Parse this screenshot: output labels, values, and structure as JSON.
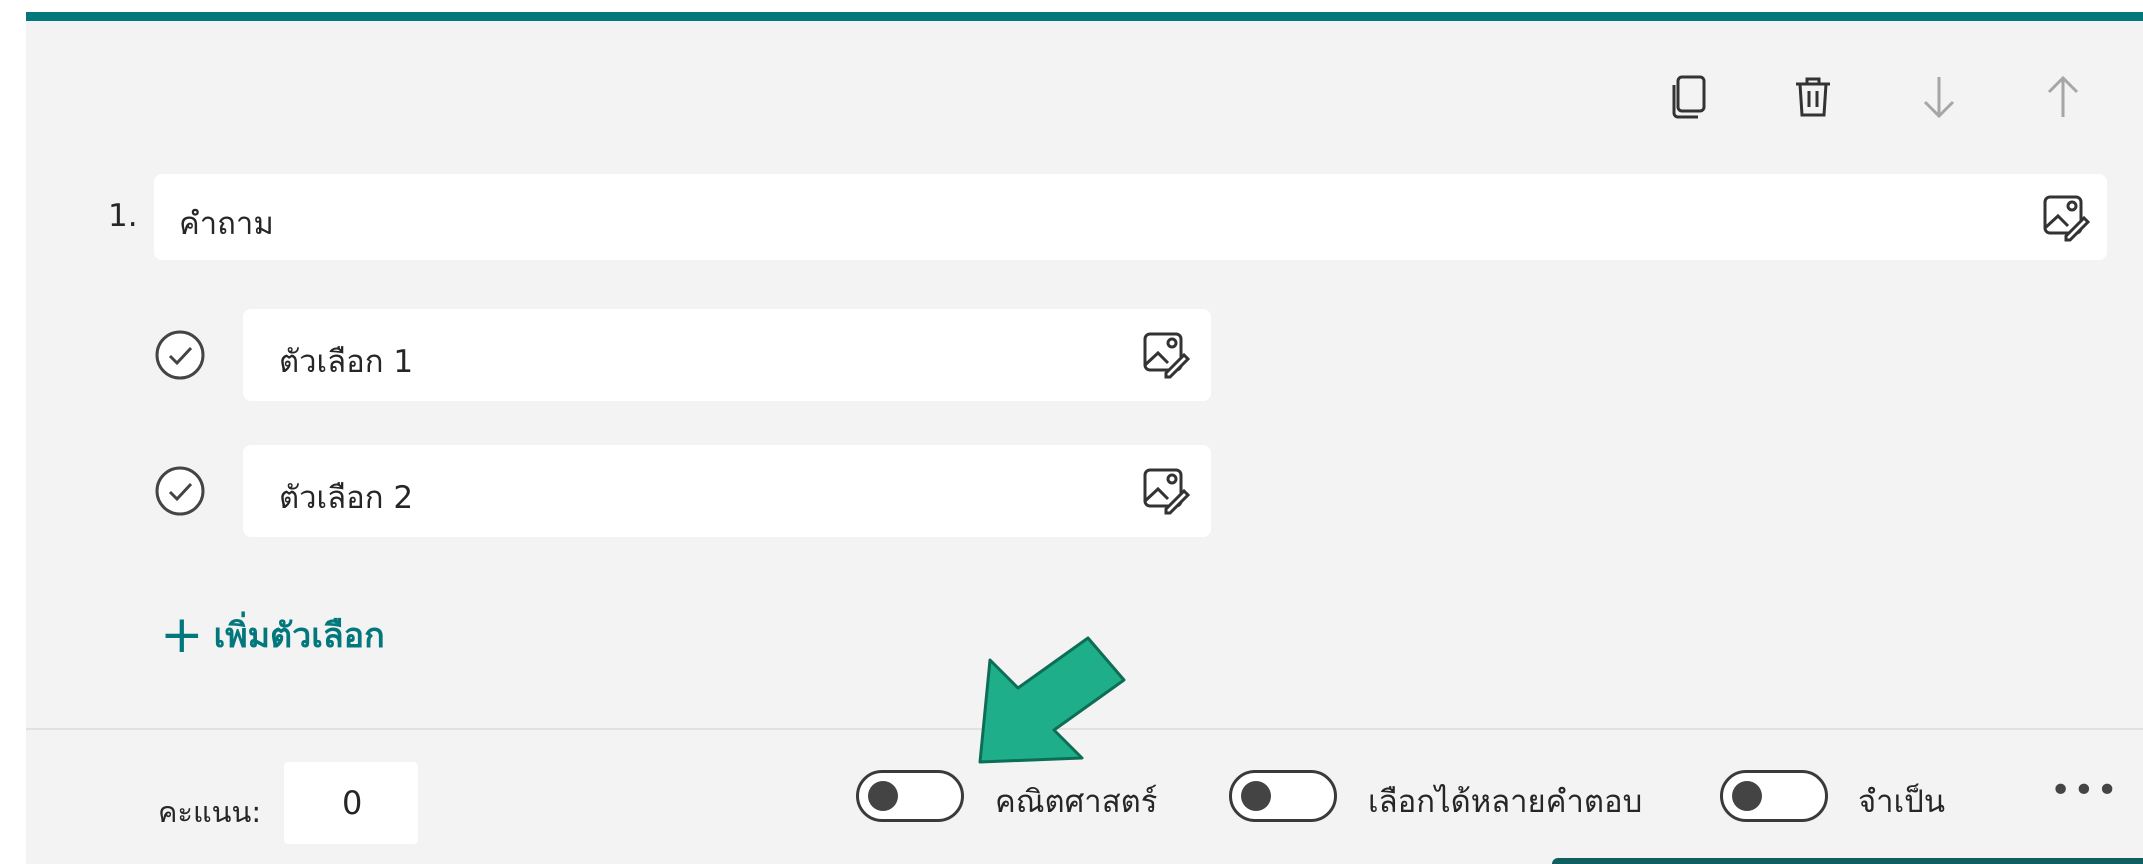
{
  "question": {
    "number": "1.",
    "text": "คำถาม"
  },
  "options": [
    {
      "text": "ตัวเลือก 1"
    },
    {
      "text": "ตัวเลือก 2"
    }
  ],
  "add_option": {
    "plus": "+",
    "label": "เพิ่มตัวเลือก"
  },
  "footer": {
    "points_label": "คะแนน:",
    "points_value": "0",
    "toggles": [
      {
        "label": "คณิตศาสตร์",
        "on": false
      },
      {
        "label": "เลือกได้หลายคำตอบ",
        "on": false
      },
      {
        "label": "จำเป็น",
        "on": false
      }
    ],
    "more": "•••"
  },
  "toolbar": {
    "icons": [
      "copy-icon",
      "trash-icon",
      "move-down-icon",
      "move-up-icon"
    ]
  },
  "colors": {
    "accent": "#03787c",
    "annotation_arrow": "#1fae8a",
    "card_bg": "#f3f3f3"
  }
}
